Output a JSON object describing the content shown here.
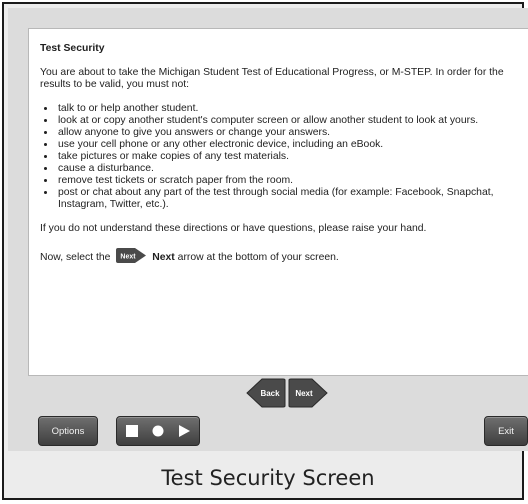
{
  "content": {
    "heading": "Test Security",
    "intro": "You are about to take the Michigan Student Test of Educational Progress, or M-STEP. In order for the results to be valid, you must not:",
    "rules": [
      "talk to or help another student.",
      "look at or copy another student's computer screen or allow another student to look at yours.",
      "allow anyone to give you answers or change your answers.",
      "use your cell phone or any other electronic device, including an eBook.",
      "take pictures or make copies of any test materials.",
      "cause a disturbance.",
      "remove test tickets or scratch paper from the room.",
      "post or chat about any part of the test through social media (for example: Facebook, Snapchat, Instagram, Twitter, etc.)."
    ],
    "help_text": "If you do not understand these directions or have questions, please raise your hand.",
    "instruction_prefix": "Now, select the",
    "instruction_icon_label": "Next",
    "instruction_bold": "Next",
    "instruction_suffix": "arrow at the bottom of your screen."
  },
  "nav": {
    "back_label": "Back",
    "next_label": "Next"
  },
  "toolbar": {
    "options_label": "Options",
    "media_icons": [
      "stop-icon",
      "record-icon",
      "play-icon"
    ],
    "exit_label": "Exit"
  },
  "caption": "Test Security Screen",
  "colors": {
    "panel_bg": "#ffffff",
    "app_bg": "#dcdcdc",
    "button_dark": "#3f3f3f",
    "arrow_dark": "#4a4a4a"
  }
}
